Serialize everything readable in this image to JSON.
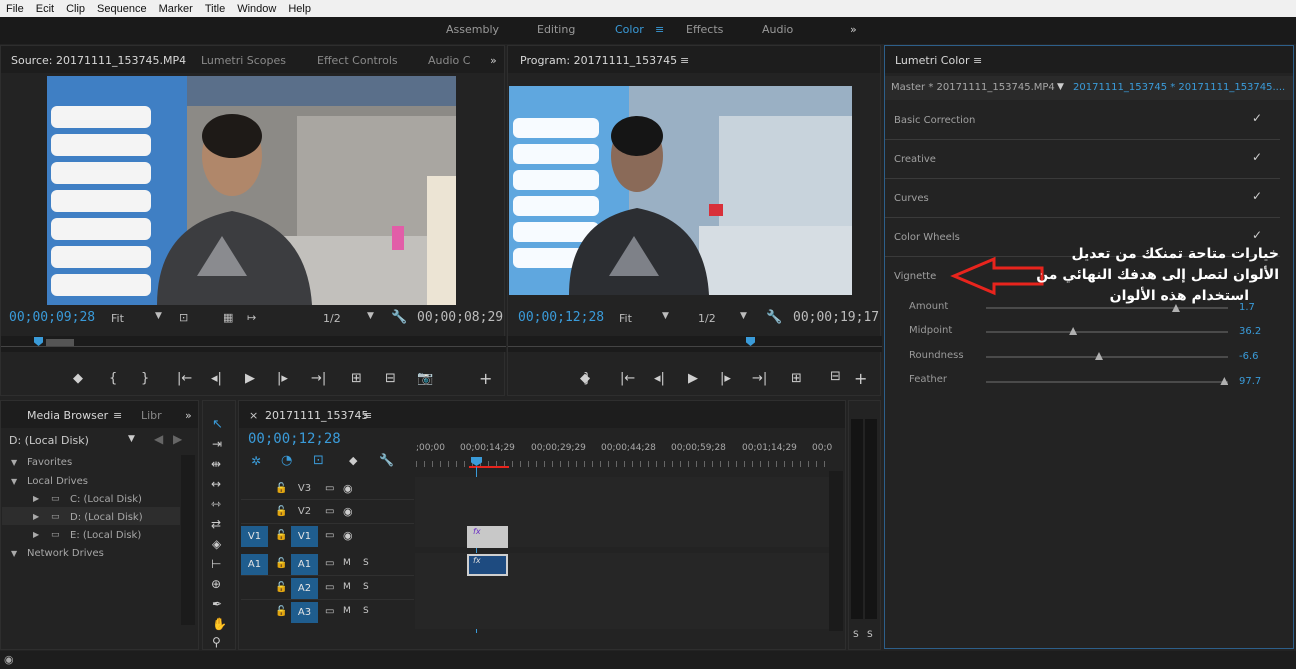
{
  "menu": [
    "File",
    "Ecit",
    "Clip",
    "Sequence",
    "Marker",
    "Title",
    "Window",
    "Help"
  ],
  "workspaces": {
    "items": [
      "Assembly",
      "Editing",
      "Color",
      "Effects",
      "Audio"
    ],
    "active": "Color",
    "more": "»",
    "menu_icon": "≡"
  },
  "source_monitor": {
    "tabs": [
      "Source: 20171111_153745.MP4",
      "Lumetri Scopes",
      "Effect Controls",
      "Audio C"
    ],
    "more": "»",
    "timecode": "00;00;09;28",
    "fit": "Fit",
    "resolution": "1/2",
    "duration": "00;00;08;29",
    "controls": [
      "◆",
      "{",
      "}",
      "|←",
      "◂|",
      "▶",
      "|▸",
      "→|",
      "⊞",
      "⊟",
      "📷",
      "+"
    ]
  },
  "program_monitor": {
    "tab": "Program: 20171111_153745",
    "menu_icon": "≡",
    "timecode": "00;00;12;28",
    "fit": "Fit",
    "resolution": "1/2",
    "duration": "00;00;19;17",
    "controls": [
      "◆",
      "}",
      "|←",
      "◂|",
      "▶",
      "|▸",
      "→|",
      "⊞",
      "⊟",
      "+"
    ]
  },
  "lumetri": {
    "title": "Lumetri Color",
    "menu_icon": "≡",
    "master": "Master * 20171111_153745.MP4",
    "clip": "20171111_153745 * 20171111_153745....",
    "sections": [
      {
        "label": "Basic Correction",
        "checked": "✓"
      },
      {
        "label": "Creative",
        "checked": "✓"
      },
      {
        "label": "Curves",
        "checked": "✓"
      },
      {
        "label": "Color Wheels",
        "checked": "✓"
      },
      {
        "label": "Vignette",
        "checked": ""
      }
    ],
    "sliders": [
      {
        "label": "Amount",
        "value": "1.7",
        "pos": 0.785
      },
      {
        "label": "Midpoint",
        "value": "36.2",
        "pos": 0.36
      },
      {
        "label": "Roundness",
        "value": "-6.6",
        "pos": 0.467
      },
      {
        "label": "Feather",
        "value": "97.7",
        "pos": 0.985
      }
    ]
  },
  "annotation": {
    "line1": "خيارات متاحة تمنكك من تعديل",
    "line2": "الألوان لتصل إلى هدفك النهائي من",
    "line3": "استخدام هذه الألوان"
  },
  "media_browser": {
    "tabs": [
      "Media Browser",
      "Libr"
    ],
    "more": "»",
    "menu_icon": "≡",
    "drive": "D: (Local Disk)",
    "tree": [
      {
        "label": "Favorites",
        "level": 0
      },
      {
        "label": "Local Drives",
        "level": 0
      },
      {
        "label": "C: (Local Disk)",
        "level": 1
      },
      {
        "label": "D: (Local Disk)",
        "level": 1
      },
      {
        "label": "E: (Local Disk)",
        "level": 1
      },
      {
        "label": "Network Drives",
        "level": 0
      }
    ]
  },
  "timeline": {
    "tab": "20171111_153745",
    "close": "×",
    "menu_icon": "≡",
    "timecode": "00;00;12;28",
    "ruler": [
      ";00;00",
      "00;00;14;29",
      "00;00;29;29",
      "00;00;44;28",
      "00;00;59;28",
      "00;01;14;29",
      "00;0"
    ],
    "video_tracks": [
      {
        "target": "",
        "name": "V3"
      },
      {
        "target": "",
        "name": "V2"
      },
      {
        "target": "V1",
        "name": "V1"
      }
    ],
    "audio_tracks": [
      {
        "target": "A1",
        "name": "A1"
      },
      {
        "target": "",
        "name": "A2"
      },
      {
        "target": "",
        "name": "A3"
      }
    ],
    "mute": "M",
    "solo": "S",
    "clip_fx": "fx"
  },
  "audio_meter": {
    "labels": [
      "S",
      "S"
    ]
  }
}
